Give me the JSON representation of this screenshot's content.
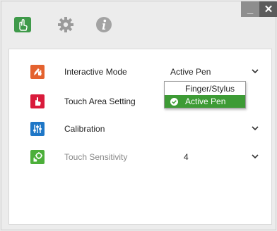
{
  "toolbar": {
    "buttons": [
      {
        "name": "touch-icon"
      },
      {
        "name": "gear-icon"
      },
      {
        "name": "info-icon"
      }
    ]
  },
  "window": {
    "minimize_label": "_",
    "close_label": "✕"
  },
  "settings": [
    {
      "label": "Interactive Mode",
      "value": "Active Pen",
      "icon": "pen-touch-icon",
      "icon_color": "#e4622f",
      "dimmed": false
    },
    {
      "label": "Touch Area Setting",
      "value": "",
      "icon": "hand-icon",
      "icon_color": "#d91b3b",
      "dimmed": false
    },
    {
      "label": "Calibration",
      "value": "",
      "icon": "sliders-icon",
      "icon_color": "#1f77c7",
      "dimmed": false
    },
    {
      "label": "Touch Sensitivity",
      "value": "4",
      "icon": "touch-gear-icon",
      "icon_color": "#4caf3a",
      "dimmed": true
    }
  ],
  "dropdown": {
    "options": [
      "Finger/Stylus",
      "Active Pen"
    ],
    "selected": "Active Pen"
  },
  "colors": {
    "accent_green": "#3d9b35",
    "toolbar_active": "#3f9a4a"
  }
}
